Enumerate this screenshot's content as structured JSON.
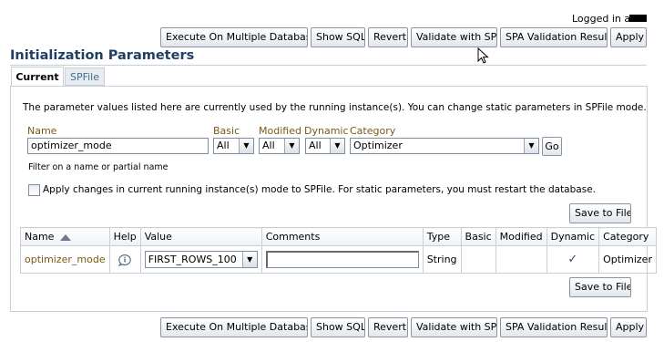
{
  "header": {
    "logged_in_label": "Logged in as",
    "title": "Initialization Parameters"
  },
  "toolbar": {
    "execute_label": "Execute On Multiple Databases",
    "show_sql_label": "Show SQL",
    "revert_label": "Revert",
    "validate_label": "Validate with SPA",
    "spa_results_label": "SPA Validation Results",
    "apply_label": "Apply"
  },
  "tabs": [
    {
      "label": "Current",
      "selected": true
    },
    {
      "label": "SPFile",
      "selected": false
    }
  ],
  "info_text": "The parameter values listed here are currently used by the running instance(s).  You can change static parameters in SPFile mode.",
  "filters": {
    "name_label": "Name",
    "name_value": "optimizer_mode",
    "name_hint": "Filter on a name or partial name",
    "basic_label": "Basic",
    "basic_value": "All",
    "modified_label": "Modified",
    "modified_value": "All",
    "dynamic_label": "Dynamic",
    "dynamic_value": "All",
    "category_label": "Category",
    "category_value": "Optimizer",
    "go_label": "Go"
  },
  "apply_spfile_text": "Apply changes in current running instance(s) mode to SPFile. For static parameters, you must restart the database.",
  "save_to_file_label": "Save to File",
  "table": {
    "columns": [
      "Name",
      "Help",
      "Value",
      "Comments",
      "Type",
      "Basic",
      "Modified",
      "Dynamic",
      "Category"
    ],
    "rows": [
      {
        "name": "optimizer_mode",
        "value": "FIRST_ROWS_100",
        "comments": "",
        "type": "String",
        "basic": "",
        "modified": "",
        "dynamic": "✓",
        "category": "Optimizer"
      }
    ]
  },
  "colors": {
    "title": "#1f3f63",
    "link": "#7a5b14",
    "border": "#c9cfd6"
  }
}
